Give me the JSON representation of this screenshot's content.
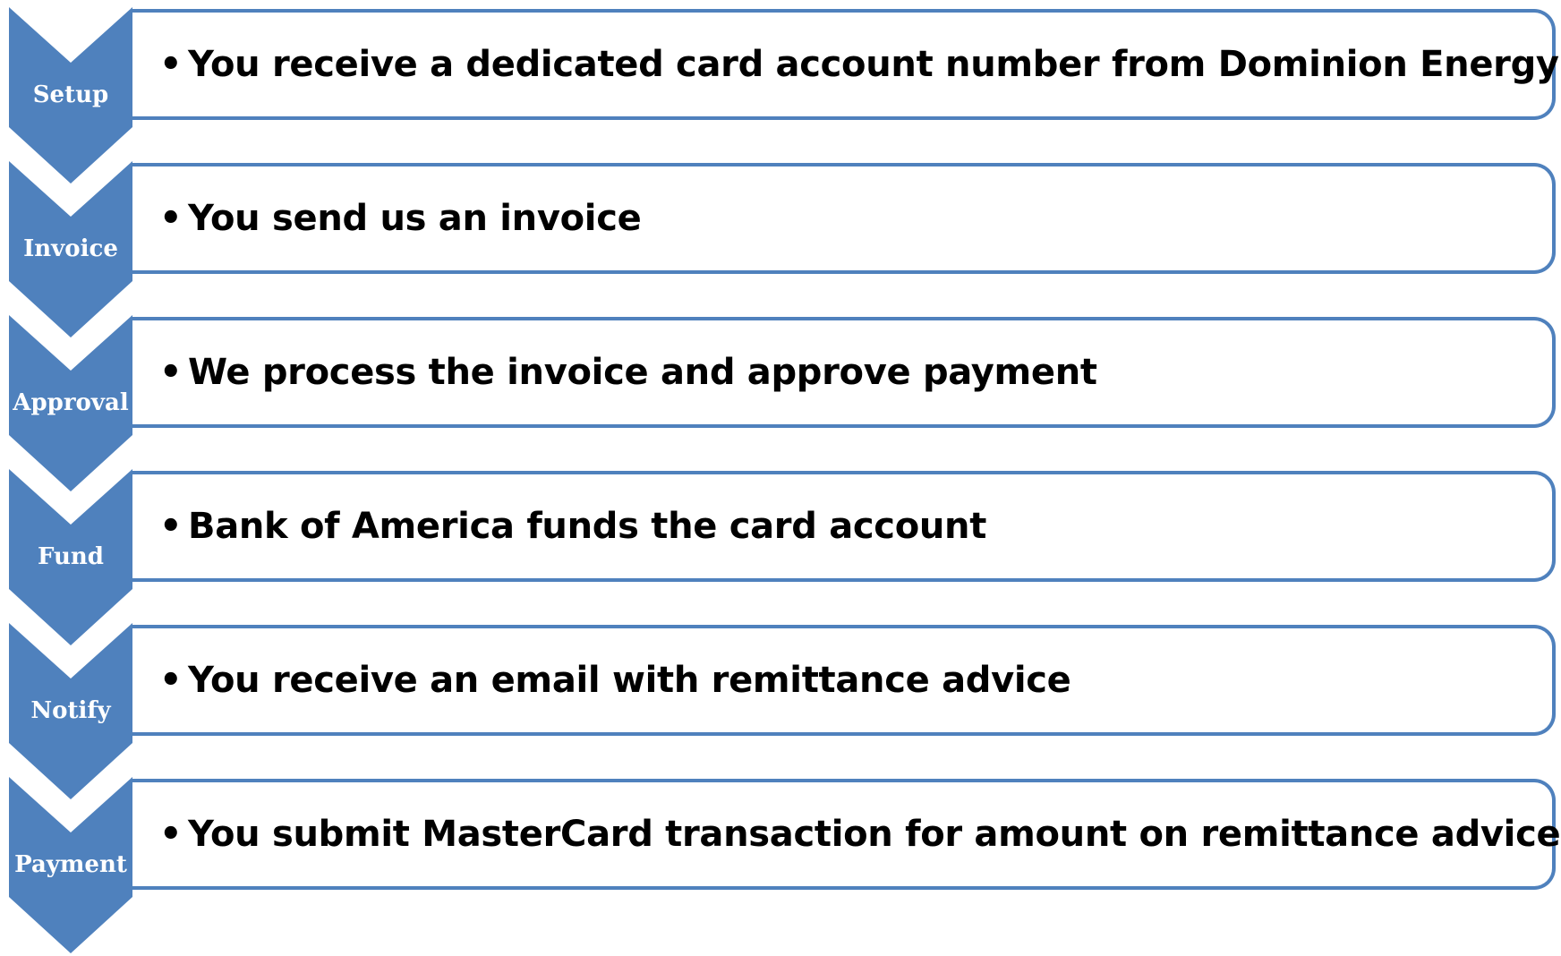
{
  "accent_color": "#4f81bd",
  "steps": [
    {
      "label": "Setup",
      "text": "You receive a dedicated card account number from Dominion Energy"
    },
    {
      "label": "Invoice",
      "text": "You send us an invoice"
    },
    {
      "label": "Approval",
      "text": "We process the invoice and approve payment"
    },
    {
      "label": "Fund",
      "text": "Bank of America funds the card account"
    },
    {
      "label": "Notify",
      "text": "You receive an email with remittance advice"
    },
    {
      "label": "Payment",
      "text": "You submit MasterCard transaction for amount on remittance advice"
    }
  ],
  "bullet": "•"
}
